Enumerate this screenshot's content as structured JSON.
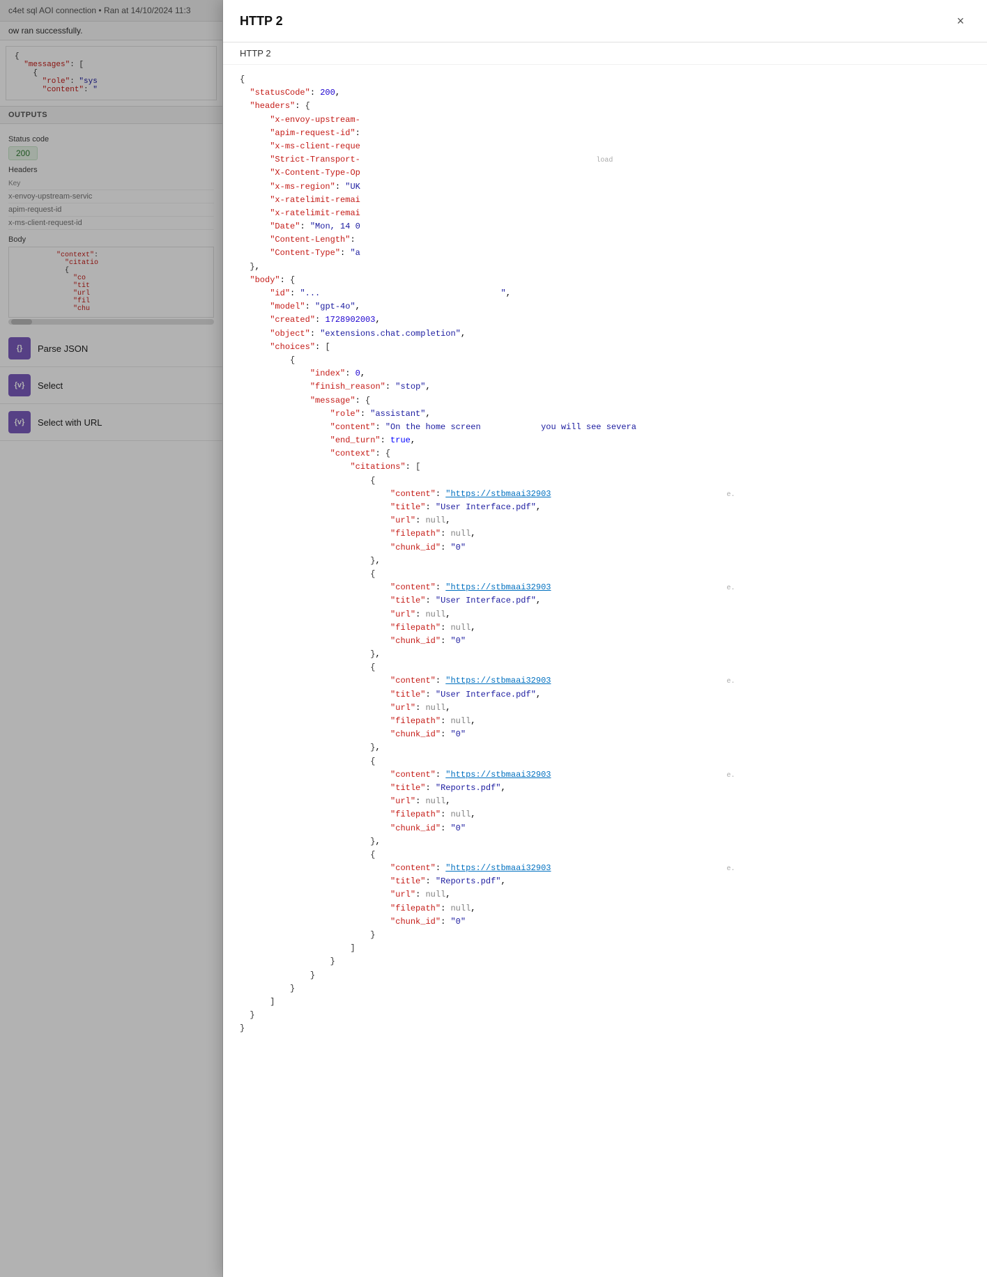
{
  "topBar": {
    "text": "c4et sql AOI connection • Ran at 14/10/2024 11:3"
  },
  "successMsg": "ow ran successfully.",
  "inputCode": {
    "lines": [
      "{",
      "  \"messages\": [",
      "    {",
      "      \"role\": \"sys",
      "      \"content\": \""
    ]
  },
  "outputs": {
    "label": "OUTPUTS",
    "statusCode": {
      "label": "Status code",
      "value": "200"
    },
    "headers": {
      "label": "Headers",
      "keyLabel": "Key",
      "keys": [
        "x-envoy-upstream-servic",
        "apim-request-id",
        "x-ms-client-request-id"
      ]
    },
    "body": {
      "label": "Body"
    }
  },
  "steps": [
    {
      "id": "parse-json",
      "icon": "{}",
      "label": "Parse JSON"
    },
    {
      "id": "select",
      "icon": "{v}",
      "label": "Select"
    },
    {
      "id": "select-with-url",
      "icon": "{v}",
      "label": "Select with URL"
    }
  ],
  "modal": {
    "title": "HTTP 2",
    "subtitle": "HTTP 2",
    "closeLabel": "×",
    "json": {
      "statusCode": 200,
      "headers": {
        "x-envoy-upstream": "x-envoy-upstream-",
        "apim-request-id": "apim-request-id",
        "x-ms-client-reque": "x-ms-client-reque",
        "Strict-Transport": "Strict-Transport-",
        "X-Content-Type-Op": "X-Content-Type-Op",
        "x-ms-region": "UK",
        "x-ratelimit-remai1": "x-ratelimit-remai",
        "x-ratelimit-remai2": "x-ratelimit-remai",
        "Date": "Mon, 14 0",
        "Content-Length": "Content-Length",
        "Content-Type": "a"
      },
      "body": {
        "id": "\"...\"",
        "model": "gpt-4o",
        "created": 1728902003,
        "object": "extensions.chat.completion",
        "choices": [
          {
            "index": 0,
            "finish_reason": "stop",
            "message": {
              "role": "assistant",
              "content": "On the home screen             you will see severa",
              "end_turn": true,
              "context": {
                "citations": [
                  {
                    "content_url": "https://stbmaai32903",
                    "title": "User Interface.pdf",
                    "url": "null",
                    "filepath": "null",
                    "chunk_id": "0"
                  },
                  {
                    "content_url": "https://stbmaai32903",
                    "title": "User Interface.pdf",
                    "url": "null",
                    "filepath": "null",
                    "chunk_id": "0"
                  },
                  {
                    "content_url": "https://stbmaai32903",
                    "title": "User Interface.pdf",
                    "url": "null",
                    "filepath": "null",
                    "chunk_id": "0"
                  },
                  {
                    "content_url": "https://stbmaai32903",
                    "title": "Reports.pdf",
                    "url": "null",
                    "filepath": "null",
                    "chunk_id": "0"
                  },
                  {
                    "content_url": "https://stbmaai32903",
                    "title": "Reports.pdf",
                    "url": "null",
                    "filepath": "null",
                    "chunk_id": "0"
                  }
                ]
              }
            }
          }
        ]
      }
    }
  },
  "colors": {
    "stepIconBg": "#7c5cbf",
    "statusOk": "#2e7d32",
    "statusOkBg": "#e8f5e9",
    "urlColor": "#0070c0",
    "keyColor": "#c41a16",
    "strColor": "#1a1a9f",
    "numColor": "#1c00cf"
  }
}
